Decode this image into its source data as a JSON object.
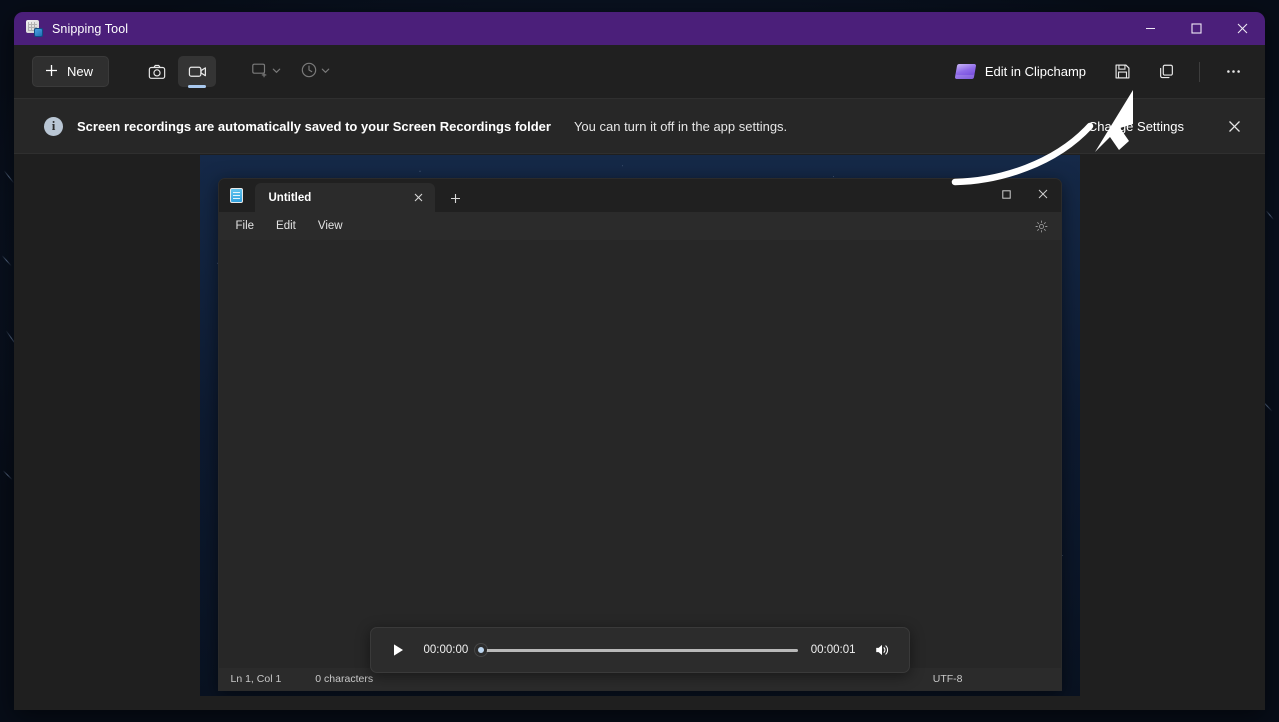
{
  "window": {
    "title": "Snipping Tool",
    "app_icon": "snipping-tool-icon",
    "controls": {
      "minimize": "—",
      "maximize": "□",
      "close": "✕"
    },
    "titlebar_color": "#4b1f7a"
  },
  "toolbar": {
    "new_label": "New",
    "new_icon": "plus-icon",
    "modes": [
      {
        "name": "screenshot",
        "icon": "camera-icon",
        "selected": false
      },
      {
        "name": "video-record",
        "icon": "video-camera-icon",
        "selected": true
      }
    ],
    "selected_indicator_color": "#a9c9ef",
    "options": [
      {
        "name": "snip-mode",
        "icon": "rectangle-snip-icon",
        "chevron": "ˇ"
      },
      {
        "name": "delay-timer",
        "icon": "clock-icon",
        "chevron": "ˇ"
      }
    ],
    "clipchamp_label": "Edit in Clipchamp",
    "clipchamp_icon": "clipchamp-icon",
    "save_icon": "save-floppy-icon",
    "copy_icon": "copy-icon",
    "more_label": "···"
  },
  "notice": {
    "icon": "info-icon",
    "icon_glyph": "i",
    "strong_text": "Screen recordings are automatically saved to your Screen Recordings folder",
    "normal_text": "You can turn it off in the app settings.",
    "link_label": "Change Settings",
    "close_glyph": "✕"
  },
  "capture": {
    "notepad": {
      "app_icon": "notepad-icon",
      "tab_label": "Untitled",
      "tab_close_glyph": "✕",
      "new_tab_glyph": "+",
      "menus": [
        "File",
        "Edit",
        "View"
      ],
      "gear_icon": "gear-icon",
      "window_controls": {
        "maximize": "□",
        "close": "✕"
      },
      "status": {
        "cursor_position": "Ln 1, Col 1",
        "character_count": "0 characters",
        "encoding": "UTF-8"
      }
    }
  },
  "player": {
    "play_icon": "play-icon",
    "current_time": "00:00:00",
    "total_time": "00:00:01",
    "progress_percent": 0,
    "volume_icon": "speaker-volume-icon"
  }
}
